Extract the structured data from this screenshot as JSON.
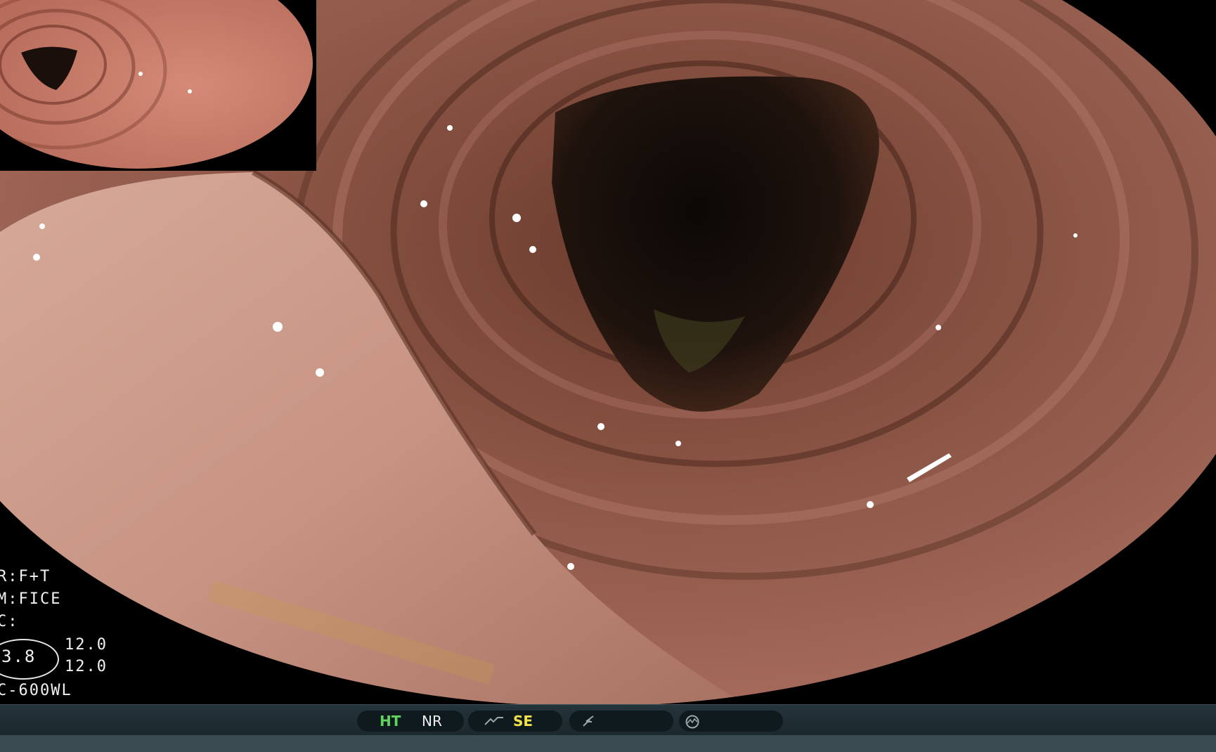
{
  "overlay": {
    "line1": "R:F+T",
    "line2": "M:FICE",
    "line3": "C:",
    "circled_value": "3.8",
    "value_top": "12.0",
    "value_bottom": "12.0",
    "model": "C-600WL"
  },
  "status_bar": {
    "ht_label": "HT",
    "nr_label": "NR",
    "se_label": "SE",
    "ht_color": "#5fd35c",
    "se_color": "#f0e24a",
    "icons": [
      "tone-curve-icon",
      "sharpness-icon",
      "signal-icon"
    ]
  }
}
